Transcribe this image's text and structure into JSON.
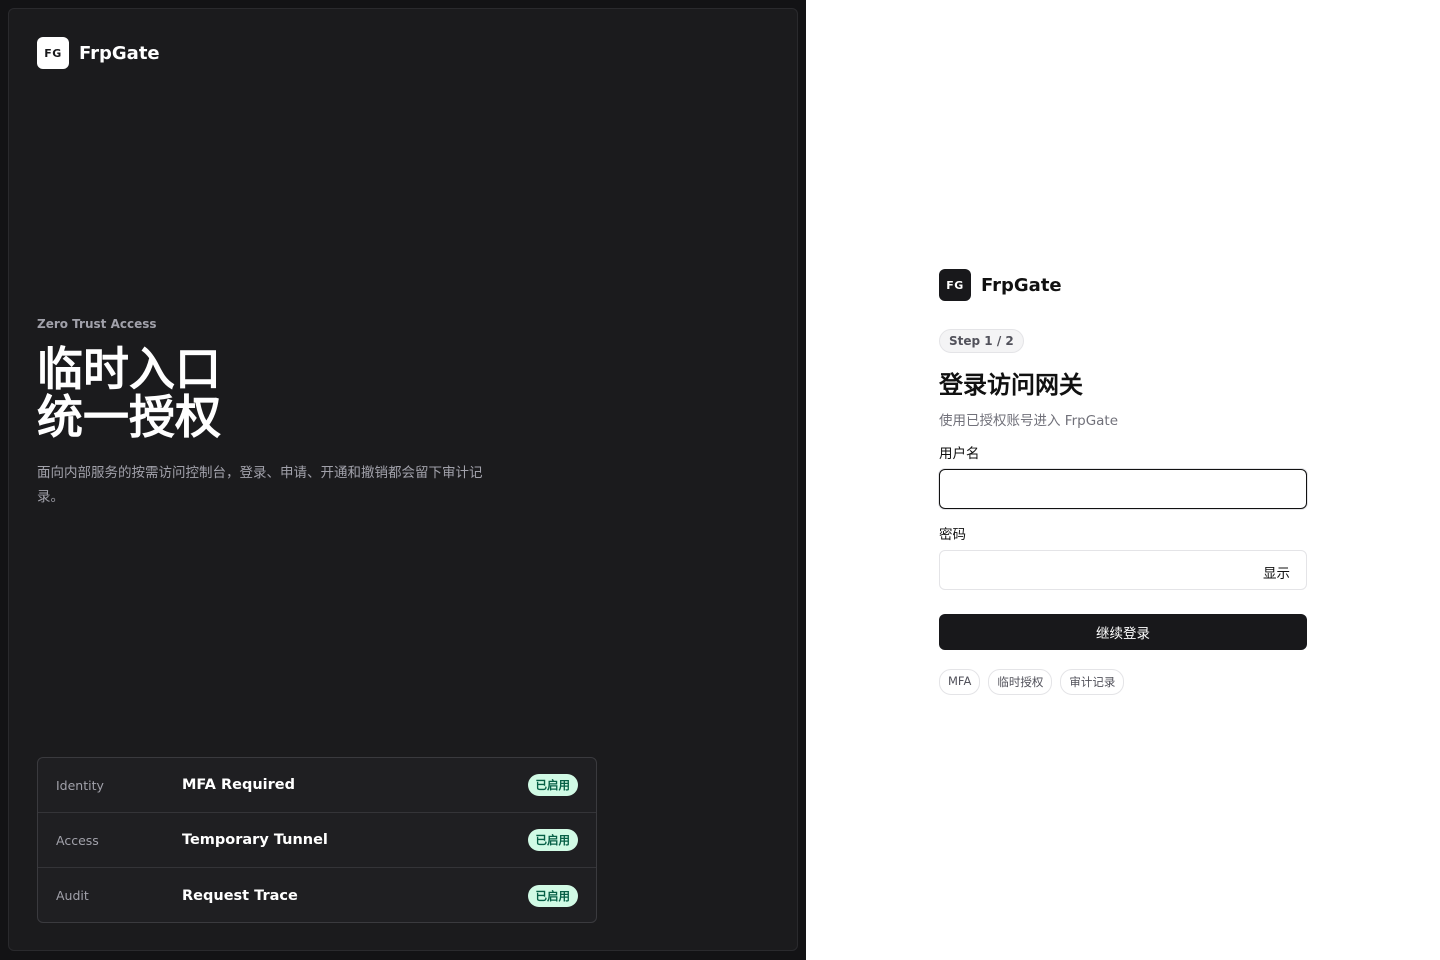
{
  "brand": {
    "logo_text": "FG",
    "name": "FrpGate"
  },
  "hero": {
    "eyebrow": "Zero Trust Access",
    "title_line1": "临时入口",
    "title_line2": "统一授权",
    "description": "面向内部服务的按需访问控制台，登录、申请、开通和撤销都会留下审计记录。"
  },
  "features": [
    {
      "category": "Identity",
      "name": "MFA Required",
      "status": "已启用"
    },
    {
      "category": "Access",
      "name": "Temporary Tunnel",
      "status": "已启用"
    },
    {
      "category": "Audit",
      "name": "Request Trace",
      "status": "已启用"
    }
  ],
  "login": {
    "step": "Step 1 / 2",
    "title": "登录访问网关",
    "subtitle": "使用已授权账号进入 FrpGate",
    "username_label": "用户名",
    "username_value": "",
    "password_label": "密码",
    "password_value": "",
    "show_label": "显示",
    "submit_label": "继续登录",
    "tags": [
      "MFA",
      "临时授权",
      "审计记录"
    ]
  },
  "colors": {
    "left_bg": "#1b1b1d",
    "accent_dark": "#18181b",
    "badge_bg": "#d1fae5",
    "badge_text": "#065f46"
  }
}
